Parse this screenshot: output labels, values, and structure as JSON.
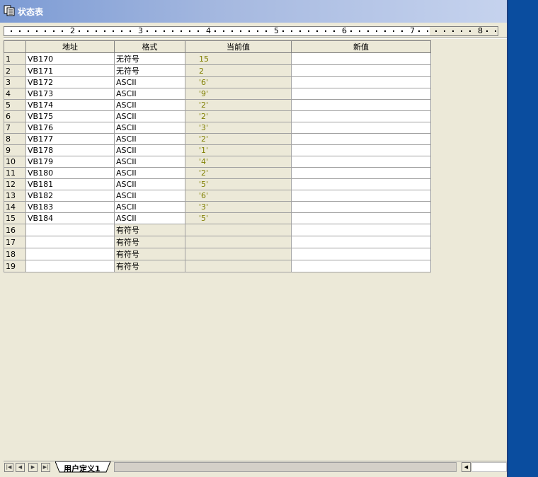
{
  "window": {
    "title": "状态表"
  },
  "ruler": {
    "labels": [
      "2",
      "3",
      "4",
      "5",
      "6",
      "7",
      "8"
    ]
  },
  "table": {
    "headers": [
      "地址",
      "格式",
      "当前值",
      "新值"
    ],
    "rows": [
      {
        "num": "1",
        "address": "VB170",
        "format": "无符号",
        "current": "15",
        "new": ""
      },
      {
        "num": "2",
        "address": "VB171",
        "format": "无符号",
        "current": "2",
        "new": ""
      },
      {
        "num": "3",
        "address": "VB172",
        "format": "ASCII",
        "current": "'6'",
        "new": ""
      },
      {
        "num": "4",
        "address": "VB173",
        "format": "ASCII",
        "current": "'9'",
        "new": ""
      },
      {
        "num": "5",
        "address": "VB174",
        "format": "ASCII",
        "current": "'2'",
        "new": ""
      },
      {
        "num": "6",
        "address": "VB175",
        "format": "ASCII",
        "current": "'2'",
        "new": ""
      },
      {
        "num": "7",
        "address": "VB176",
        "format": "ASCII",
        "current": "'3'",
        "new": ""
      },
      {
        "num": "8",
        "address": "VB177",
        "format": "ASCII",
        "current": "'2'",
        "new": ""
      },
      {
        "num": "9",
        "address": "VB178",
        "format": "ASCII",
        "current": "'1'",
        "new": ""
      },
      {
        "num": "10",
        "address": "VB179",
        "format": "ASCII",
        "current": "'4'",
        "new": ""
      },
      {
        "num": "11",
        "address": "VB180",
        "format": "ASCII",
        "current": "'2'",
        "new": ""
      },
      {
        "num": "12",
        "address": "VB181",
        "format": "ASCII",
        "current": "'5'",
        "new": ""
      },
      {
        "num": "13",
        "address": "VB182",
        "format": "ASCII",
        "current": "'6'",
        "new": ""
      },
      {
        "num": "14",
        "address": "VB183",
        "format": "ASCII",
        "current": "'3'",
        "new": ""
      },
      {
        "num": "15",
        "address": "VB184",
        "format": "ASCII",
        "current": "'5'",
        "new": ""
      },
      {
        "num": "16",
        "address": "",
        "format": "有符号",
        "current": "",
        "new": ""
      },
      {
        "num": "17",
        "address": "",
        "format": "有符号",
        "current": "",
        "new": ""
      },
      {
        "num": "18",
        "address": "",
        "format": "有符号",
        "current": "",
        "new": ""
      },
      {
        "num": "19",
        "address": "",
        "format": "有符号",
        "current": "",
        "new": ""
      }
    ]
  },
  "tabs": [
    {
      "label": "用户定义1"
    }
  ],
  "colors": {
    "current_value_text": "#7f7f00",
    "right_band": "#0a4d9f",
    "window_bg": "#ece9d8"
  },
  "icons": {
    "title": "status-table-icon",
    "nav": [
      "first-tab-icon",
      "prev-tab-icon",
      "next-tab-icon",
      "last-tab-icon"
    ]
  }
}
